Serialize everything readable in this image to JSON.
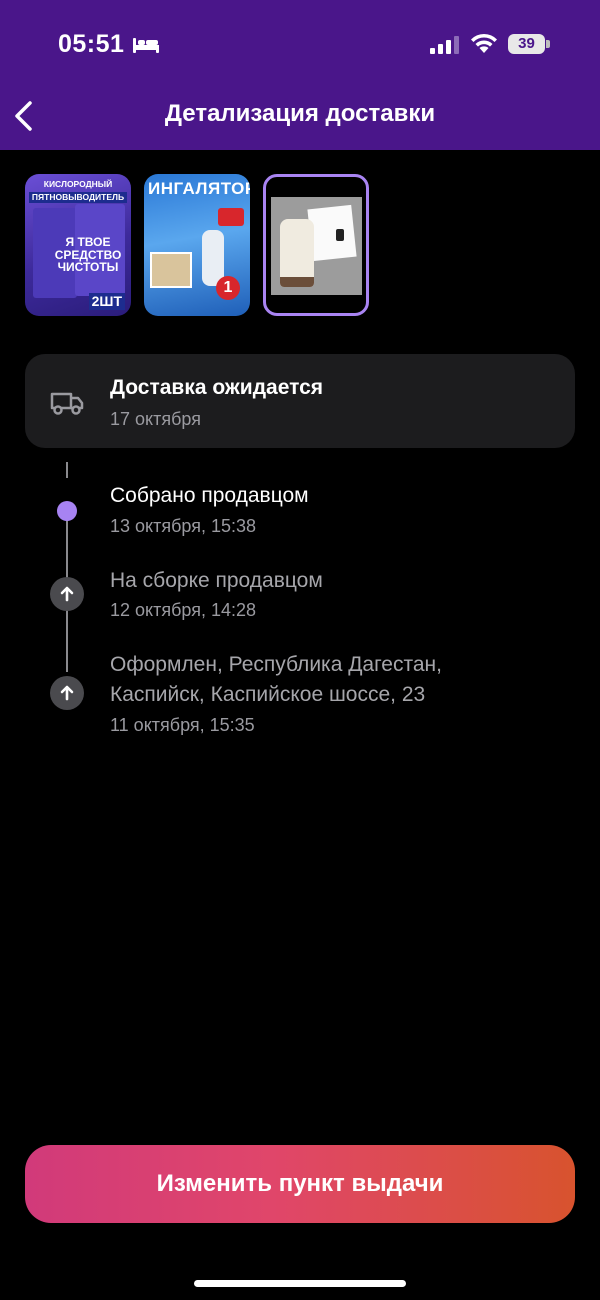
{
  "status_bar": {
    "time": "05:51",
    "battery": "39"
  },
  "header": {
    "title": "Детализация доставки"
  },
  "thumbnails": [
    {
      "lines": [
        "КИСЛОРОДНЫЙ",
        "ПЯТНОВЫВОДИТЕЛЬ",
        "Я ТВОЕ СРЕДСТВО ЧИСТОТЫ",
        "2ШТ"
      ]
    },
    {
      "lines": [
        "ИНГАЛЯТОР",
        "1"
      ]
    },
    {
      "lines": []
    }
  ],
  "delivery": {
    "title": "Доставка ожидается",
    "date": "17 октября"
  },
  "timeline": [
    {
      "title": "Собрано продавцом",
      "date": "13 октября, 15:38"
    },
    {
      "title": "На сборке продавцом",
      "date": "12 октября, 14:28"
    },
    {
      "title_line1": "Оформлен, Республика Дагестан,",
      "title_line2": "Каспийск, Каспийское шоссе, 23",
      "date": "11 октября, 15:35"
    }
  ],
  "action_button": {
    "label": "Изменить пункт выдачи"
  },
  "colors": {
    "header_bg": "#4a168a",
    "accent": "#a783f2",
    "button_start": "#d13a7a",
    "button_end": "#d8532e"
  }
}
